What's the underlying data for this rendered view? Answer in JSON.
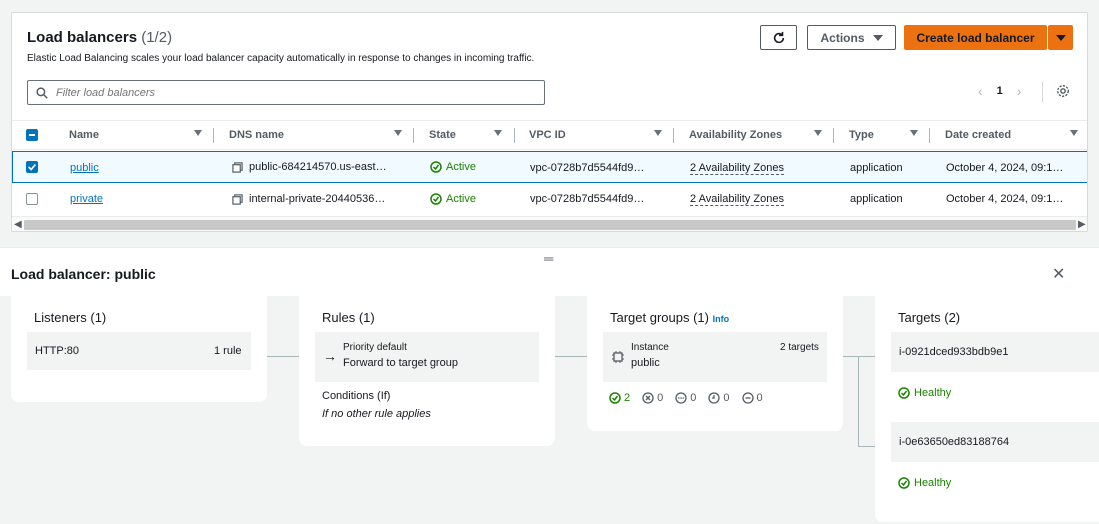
{
  "header": {
    "title": "Load balancers",
    "count": "(1/2)",
    "subtitle": "Elastic Load Balancing scales your load balancer capacity automatically in response to changes in incoming traffic.",
    "actions_label": "Actions",
    "create_label": "Create load balancer",
    "search_placeholder": "Filter load balancers",
    "page": "1"
  },
  "columns": [
    "Name",
    "DNS name",
    "State",
    "VPC ID",
    "Availability Zones",
    "Type",
    "Date created"
  ],
  "rows": [
    {
      "name": "public",
      "dns": "public-684214570.us-east…",
      "state": "Active",
      "vpc": "vpc-0728b7d5544fd9…",
      "az": "2 Availability Zones",
      "type": "application",
      "date": "October 4, 2024, 09:1…",
      "selected": true
    },
    {
      "name": "private",
      "dns": "internal-private-20440536…",
      "state": "Active",
      "vpc": "vpc-0728b7d5544fd9…",
      "az": "2 Availability Zones",
      "type": "application",
      "date": "October 4, 2024, 09:1…",
      "selected": false
    }
  ],
  "detail": {
    "title": "Load balancer: public",
    "listeners": {
      "heading": "Listeners (1)",
      "protocol": "HTTP:80",
      "rules": "1 rule"
    },
    "rules": {
      "heading": "Rules (1)",
      "priority": "Priority default",
      "action": "Forward to target group",
      "conditions": "Conditions (If)",
      "conditions_text": "If no other rule applies"
    },
    "target_groups": {
      "heading": "Target groups (1)",
      "info": "Info",
      "type": "Instance",
      "name": "public",
      "targets": "2 targets",
      "healthy": "2",
      "unhealthy": "0",
      "unused": "0",
      "initial": "0",
      "draining": "0"
    },
    "targets": {
      "heading": "Targets (2)",
      "items": [
        {
          "id": "i-0921dced933bdb9e1",
          "status": "Healthy"
        },
        {
          "id": "i-0e63650ed83188764",
          "status": "Healthy"
        }
      ]
    }
  },
  "colors": {
    "accent": "#ec7211",
    "link": "#0073bb",
    "success": "#1d8102"
  }
}
